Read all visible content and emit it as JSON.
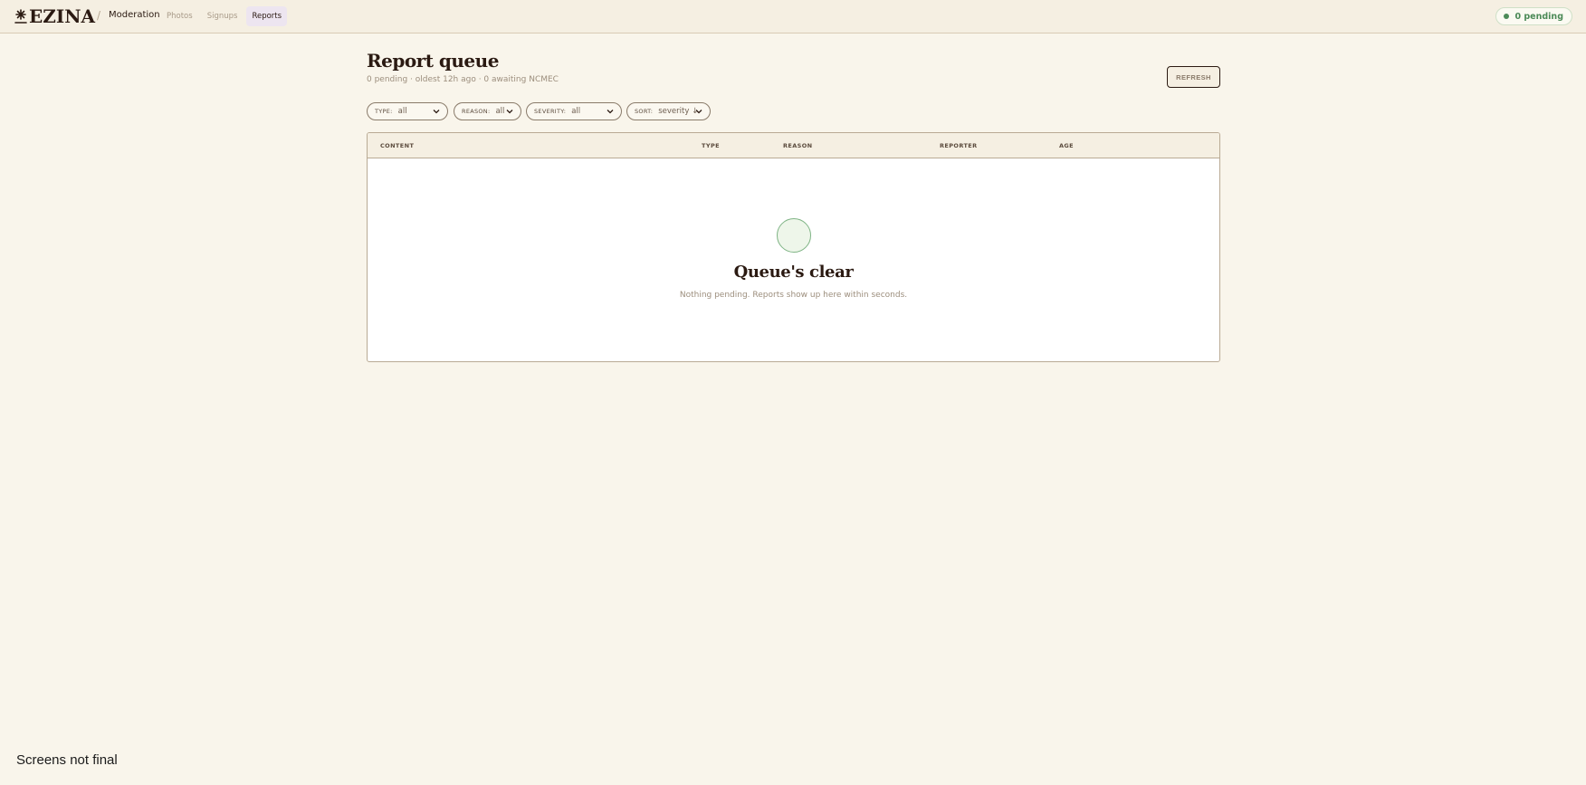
{
  "header": {
    "logo_text": "EZINA",
    "separator": "/",
    "section": "Moderation",
    "tabs": [
      {
        "label": "Photos"
      },
      {
        "label": "Signups"
      },
      {
        "label": "Reports"
      }
    ],
    "active_tab": "Reports",
    "pending_badge": "0 pending"
  },
  "page": {
    "title": "Report queue",
    "subtitle": "0 pending · oldest 12h ago · 0 awaiting NCMEC",
    "refresh_label": "REFRESH"
  },
  "filters": [
    {
      "key": "TYPE:",
      "value": "all"
    },
    {
      "key": "REASON:",
      "value": "all"
    },
    {
      "key": "SEVERITY:",
      "value": "all"
    },
    {
      "key": "SORT:",
      "value": "severity ↓"
    }
  ],
  "table": {
    "columns": [
      "CONTENT",
      "TYPE",
      "REASON",
      "REPORTER",
      "AGE"
    ],
    "rows": [],
    "empty_title": "Queue's clear",
    "empty_subtitle": "Nothing pending. Reports show up here within seconds."
  },
  "footer_note": "Screens not final",
  "colors": {
    "background": "#f9f5eb",
    "ink": "#2b1a12",
    "success": "#4c8a57",
    "border": "#b9aa94"
  }
}
